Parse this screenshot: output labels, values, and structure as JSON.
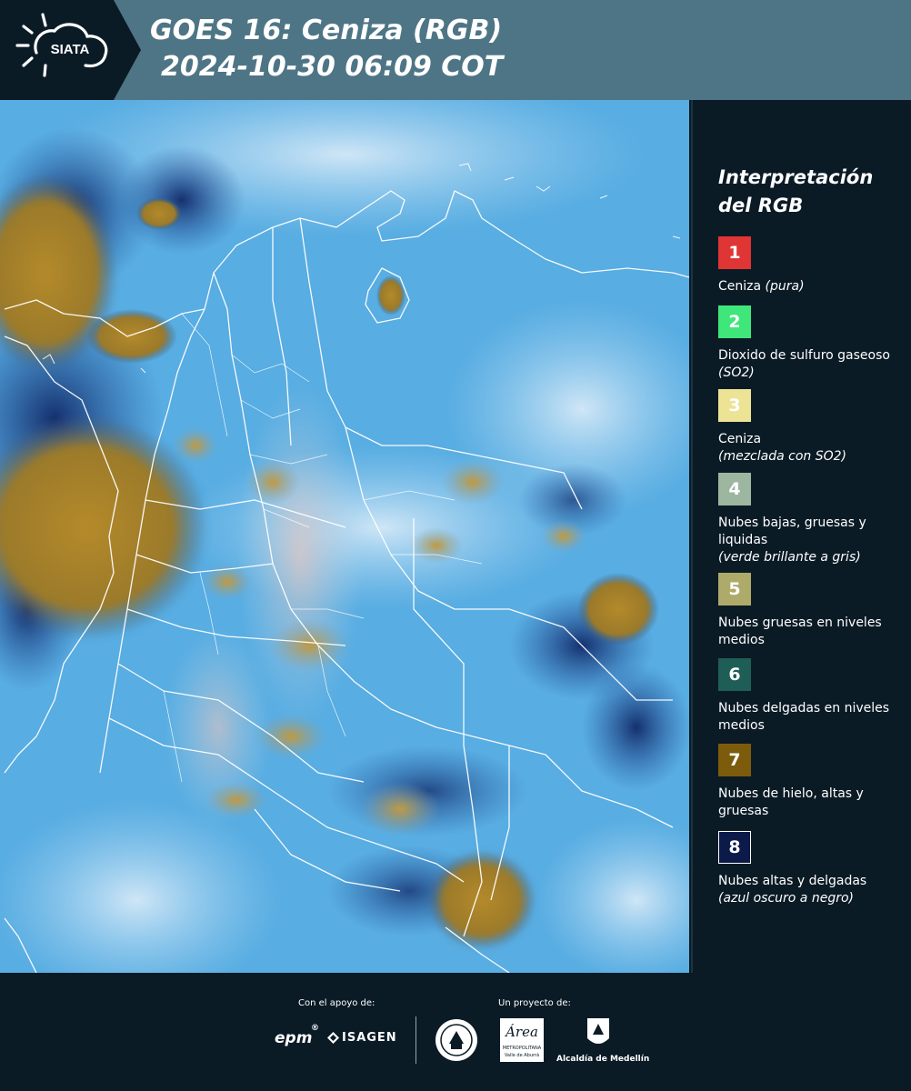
{
  "header": {
    "brand": "SIATA",
    "title_line1": "GOES 16: Ceniza (RGB)",
    "title_line2": "2024-10-30 06:09 COT",
    "background_color": "#4e7585"
  },
  "legend": {
    "title_line1": "Interpretación",
    "title_line2": "del RGB",
    "items": [
      {
        "num": "1",
        "color": "#e03535",
        "text": "Ceniza",
        "note": "(pura)"
      },
      {
        "num": "2",
        "color": "#3fe67a",
        "text": "Dioxido de sulfuro gaseoso",
        "note": "(SO2)"
      },
      {
        "num": "3",
        "color": "#ece394",
        "text": "Ceniza",
        "note": "(mezclada con SO2)"
      },
      {
        "num": "4",
        "color": "#9db6a0",
        "text": "Nubes bajas, gruesas y liquidas",
        "note": "(verde brillante a gris)"
      },
      {
        "num": "5",
        "color": "#aeaa6a",
        "text": "Nubes gruesas en niveles medios",
        "note": ""
      },
      {
        "num": "6",
        "color": "#1e5e57",
        "text": "Nubes delgadas en niveles medios",
        "note": ""
      },
      {
        "num": "7",
        "color": "#7c5c0c",
        "text": "Nubes de hielo, altas y gruesas",
        "note": ""
      },
      {
        "num": "8",
        "color": "#0c1a4a",
        "text": "Nubes altas y delgadas",
        "note": "(azul oscuro a negro)"
      }
    ]
  },
  "footer": {
    "support_label": "Con el apoyo de:",
    "project_label": "Un proyecto de:",
    "logo_epm": "epm",
    "logo_isagen": "ISAGEN",
    "logo_area_title": "Área",
    "logo_area_sub1": "METROPOLITANA",
    "logo_area_sub2": "Valle de Aburrá",
    "logo_medellin": "Alcaldía de Medellín"
  }
}
